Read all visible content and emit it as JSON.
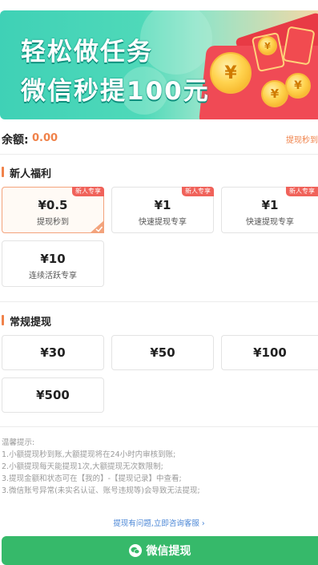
{
  "banner": {
    "line1": "轻松做任务",
    "line2": "微信秒提100元",
    "coin_symbol": "¥"
  },
  "balance": {
    "label": "余额:",
    "value": "0.00",
    "link": "提现秒到"
  },
  "new_user": {
    "title": "新人福利",
    "tag": "新人专享",
    "cards": [
      {
        "price": "¥0.5",
        "desc": "提现秒到",
        "tag": "新人专享",
        "selected": true
      },
      {
        "price": "¥1",
        "desc": "快速提现专享",
        "tag": "新人专享",
        "selected": false
      },
      {
        "price": "¥1",
        "desc": "快速提现专享",
        "tag": "新人专享",
        "selected": false
      },
      {
        "price": "¥10",
        "desc": "连续活跃专享",
        "tag": "",
        "selected": false
      }
    ]
  },
  "regular": {
    "title": "常规提现",
    "amounts": [
      "¥30",
      "¥50",
      "¥100",
      "¥500"
    ]
  },
  "tips": {
    "heading": "温馨提示:",
    "lines": [
      "1.小额提现秒到账,大额提现将在24小时内审核到账;",
      "2.小额提现每天能提现1次,大额提现无次数限制;",
      "3.提现金额和状态可在【我的】-【提现记录】中查看;",
      "3.微信账号异常(未实名认证、账号违规等)会导致无法提现;"
    ]
  },
  "help_link": "提现有问题,立即咨询客服 ›",
  "button": {
    "label": "微信提现",
    "color": "#36b96a"
  },
  "colors": {
    "accent": "#f0824a",
    "tag": "#f0625a",
    "link": "#4a86d6"
  }
}
